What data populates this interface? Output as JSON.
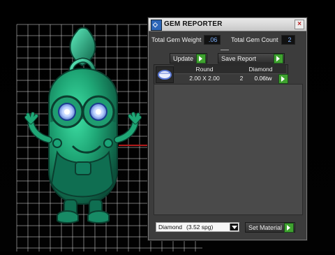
{
  "window": {
    "title": "GEM REPORTER",
    "close_glyph": "×"
  },
  "summary": {
    "total_weight_label": "Total Gem Weight",
    "total_weight_value": ".06",
    "total_count_label": "Total Gem Count",
    "total_count_value": "2"
  },
  "actions": {
    "update_label": "Update",
    "save_report_label": "Save Report",
    "set_material_label": "Set Material"
  },
  "table": {
    "headers": [
      "Round",
      "Diamond"
    ],
    "rows": [
      {
        "size": "2.00 X 2.00",
        "count": "2",
        "weight": "0.06tw"
      }
    ]
  },
  "material": {
    "selected": "Diamond",
    "detail": "(3.52 spg)"
  },
  "icons": {
    "app": "gem-icon",
    "gem_row": "gem-thumbnail-icon",
    "action": "play-arrow-icon"
  },
  "colors": {
    "figure": "#1fa776",
    "grid": "#d6d6d6",
    "accent_button": "#3fa22f",
    "value_text": "#7fb2ff"
  }
}
